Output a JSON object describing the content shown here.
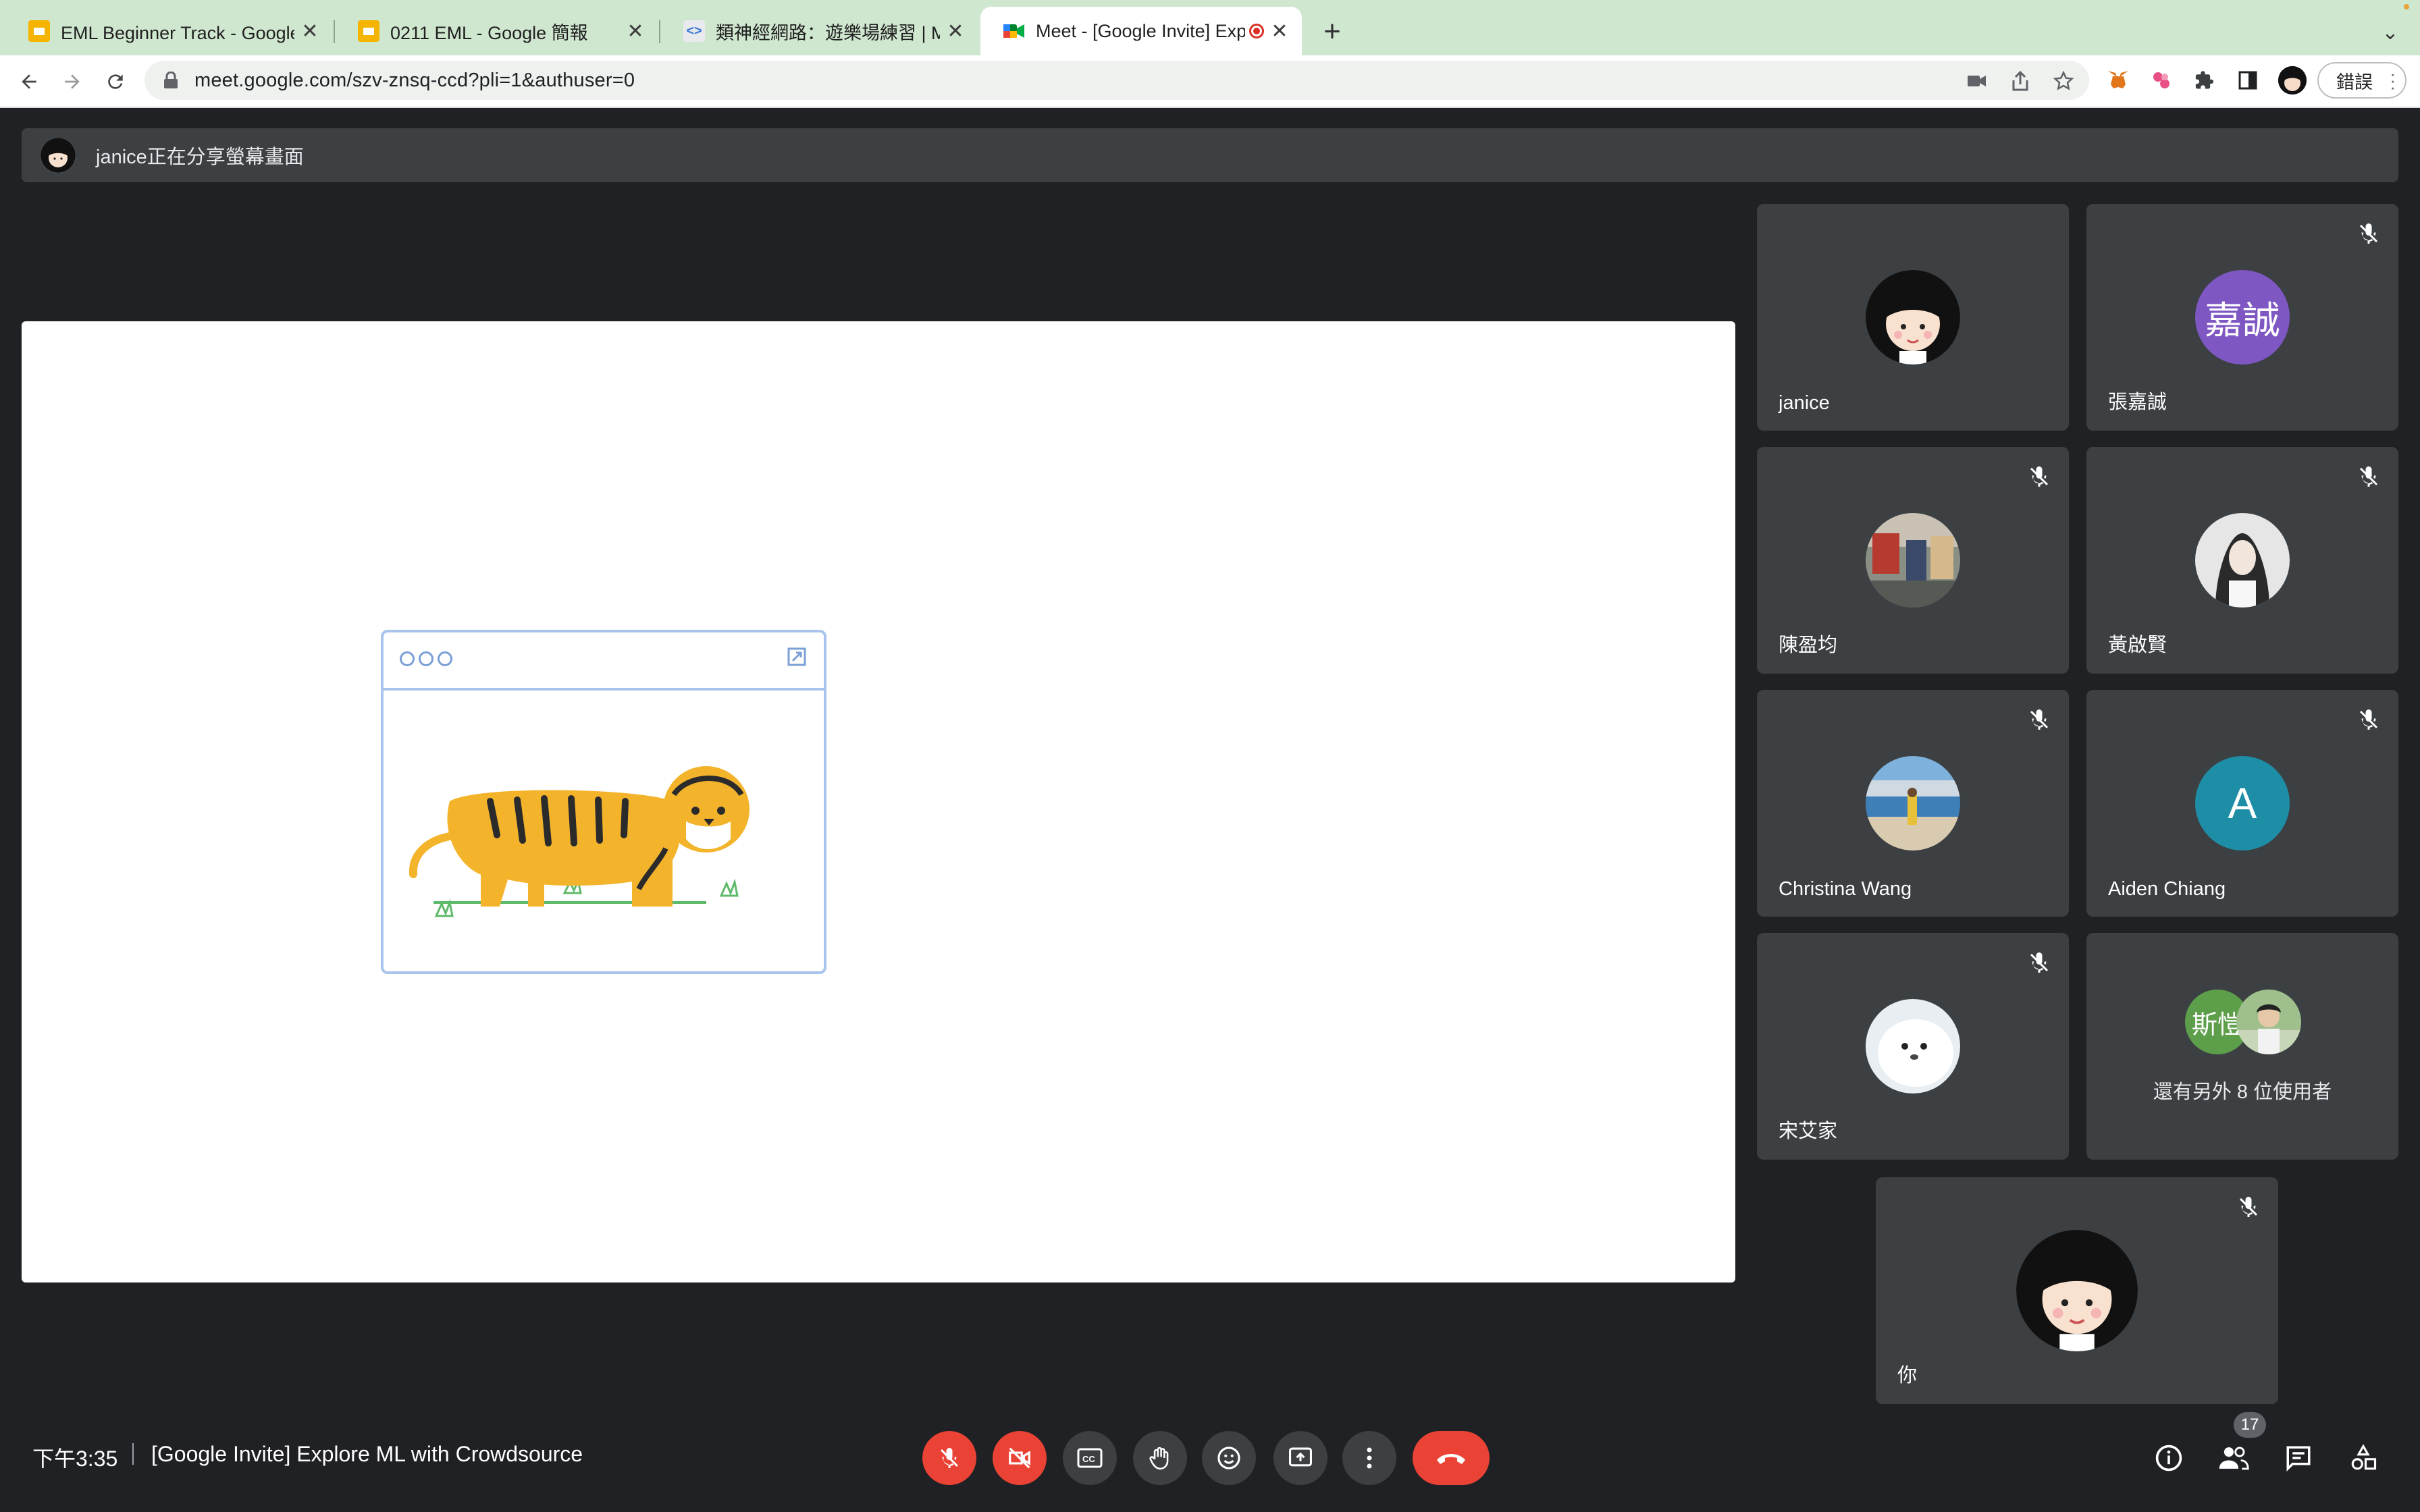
{
  "browser": {
    "tabs": [
      {
        "title": "EML Beginner Track - Google 簡報",
        "favicon": "slides-icon"
      },
      {
        "title": "0211 EML - Google 簡報",
        "favicon": "slides-icon"
      },
      {
        "title": "類神經網路：遊樂場練習 | Machine Learning",
        "favicon": "code-icon"
      },
      {
        "title": "Meet - [Google Invite] Explore ML with Crowdsource",
        "favicon": "meet-icon",
        "active": true,
        "recording": true
      }
    ],
    "url": "meet.google.com/szv-znsq-ccd?pli=1&authuser=0",
    "error_button": "錯誤"
  },
  "banner": {
    "text": "janice正在分享螢幕畫面"
  },
  "participants": [
    {
      "name": "janice",
      "muted": false,
      "avatar": "cartoon-girl"
    },
    {
      "name": "張嘉誠",
      "muted": true,
      "avatar_text": "嘉誠",
      "avatar_color": "#7e57c2"
    },
    {
      "name": "陳盈均",
      "muted": true,
      "avatar": "photo-street"
    },
    {
      "name": "黃啟賢",
      "muted": true,
      "avatar": "photo-portrait"
    },
    {
      "name": "Christina Wang",
      "muted": true,
      "avatar": "photo-beach"
    },
    {
      "name": "Aiden Chiang",
      "muted": true,
      "avatar_text": "A",
      "avatar_color": "#1e8ea7"
    },
    {
      "name": "宋艾家",
      "muted": true,
      "avatar": "photo-seal"
    }
  ],
  "more": {
    "text": "還有另外 8 位使用者",
    "avatar_text": "斯愷",
    "avatar_color": "#5d9e4a"
  },
  "self": {
    "name": "你",
    "muted": true
  },
  "bottom": {
    "time": "下午3:35",
    "meeting_title": "[Google Invite] Explore ML with Crowdsource",
    "people_count": "17"
  },
  "colors": {
    "background": "#202124",
    "tile": "#3c4043",
    "danger": "#ea4335",
    "tabstrip": "#cfe6cf"
  }
}
